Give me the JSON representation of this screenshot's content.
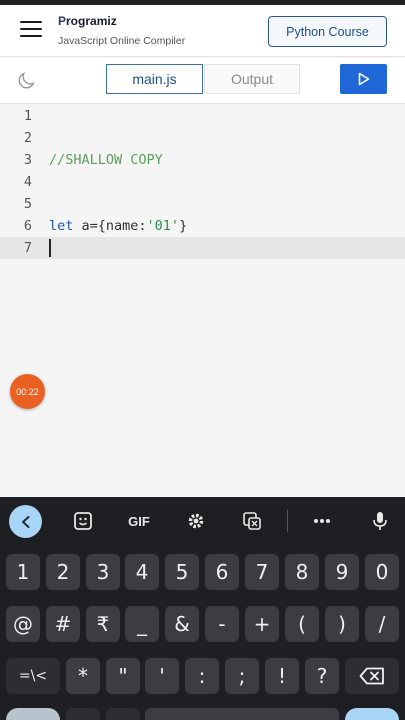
{
  "header": {
    "logo_text": "rogramiz",
    "logo_initial": "P",
    "subtitle": "JavaScript Online Compiler",
    "course_button": "Python Course"
  },
  "toolbar": {
    "tab_main": "main.js",
    "tab_output": "Output",
    "run_icon": "play-icon",
    "theme_icon": "moon-icon"
  },
  "editor": {
    "lines": [
      {
        "number": "1",
        "text": ""
      },
      {
        "number": "2",
        "text": ""
      },
      {
        "number": "3",
        "text": "//SHALLOW COPY"
      },
      {
        "number": "4",
        "text": ""
      },
      {
        "number": "5",
        "text": ""
      },
      {
        "number": "6",
        "keyword": "let",
        "rest": " a={name:",
        "string": "'01'",
        "end": "}"
      },
      {
        "number": "7",
        "text": ""
      }
    ],
    "active_line": 7
  },
  "timer": "00:22",
  "keyboard": {
    "toolbar_labels": {
      "gif": "GIF"
    },
    "row_numbers": [
      "1",
      "2",
      "3",
      "4",
      "5",
      "6",
      "7",
      "8",
      "9",
      "0"
    ],
    "row_symbols": [
      "@",
      "#",
      "₹",
      "_",
      "&",
      "-",
      "+",
      "(",
      ")",
      "/"
    ],
    "row_punct": [
      "=\\<",
      "*",
      "\"",
      "'",
      ":",
      "!",
      "?"
    ],
    "colors": {
      "background": "#1e1f22",
      "key": "#3b3d42",
      "accent": "#a8d4f5"
    }
  }
}
